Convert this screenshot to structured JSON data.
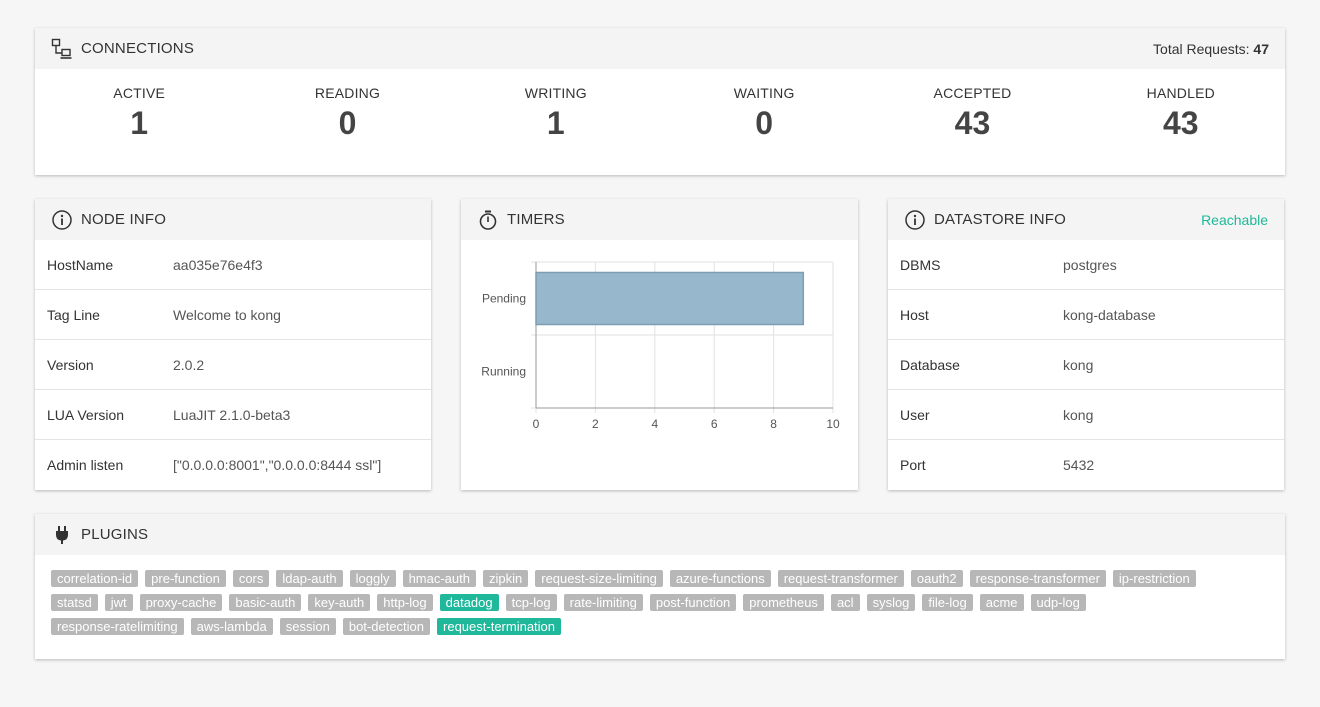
{
  "connections": {
    "title": "CONNECTIONS",
    "total_label": "Total Requests:",
    "total_value": "47",
    "stats": [
      {
        "label": "ACTIVE",
        "value": "1"
      },
      {
        "label": "READING",
        "value": "0"
      },
      {
        "label": "WRITING",
        "value": "1"
      },
      {
        "label": "WAITING",
        "value": "0"
      },
      {
        "label": "ACCEPTED",
        "value": "43"
      },
      {
        "label": "HANDLED",
        "value": "43"
      }
    ]
  },
  "node_info": {
    "title": "NODE INFO",
    "rows": [
      {
        "key": "HostName",
        "value": "aa035e76e4f3"
      },
      {
        "key": "Tag Line",
        "value": "Welcome to kong"
      },
      {
        "key": "Version",
        "value": "2.0.2"
      },
      {
        "key": "LUA Version",
        "value": "LuaJIT 2.1.0-beta3"
      },
      {
        "key": "Admin listen",
        "value": "[\"0.0.0.0:8001\",\"0.0.0.0:8444 ssl\"]"
      }
    ]
  },
  "timers": {
    "title": "TIMERS"
  },
  "chart_data": {
    "type": "bar",
    "orientation": "horizontal",
    "categories": [
      "Pending",
      "Running"
    ],
    "values": [
      9,
      0
    ],
    "xlim": [
      0,
      10
    ],
    "x_ticks": [
      "0",
      "2",
      "4",
      "6",
      "8",
      "10"
    ],
    "grid": true,
    "bar_color": "#97b8cc",
    "bar_stroke": "#7d9db2"
  },
  "datastore": {
    "title": "DATASTORE INFO",
    "status": "Reachable",
    "rows": [
      {
        "key": "DBMS",
        "value": "postgres"
      },
      {
        "key": "Host",
        "value": "kong-database"
      },
      {
        "key": "Database",
        "value": "kong"
      },
      {
        "key": "User",
        "value": "kong"
      },
      {
        "key": "Port",
        "value": "5432"
      }
    ]
  },
  "plugins": {
    "title": "PLUGINS",
    "items": [
      {
        "name": "correlation-id",
        "enabled": false
      },
      {
        "name": "pre-function",
        "enabled": false
      },
      {
        "name": "cors",
        "enabled": false
      },
      {
        "name": "ldap-auth",
        "enabled": false
      },
      {
        "name": "loggly",
        "enabled": false
      },
      {
        "name": "hmac-auth",
        "enabled": false
      },
      {
        "name": "zipkin",
        "enabled": false
      },
      {
        "name": "request-size-limiting",
        "enabled": false
      },
      {
        "name": "azure-functions",
        "enabled": false
      },
      {
        "name": "request-transformer",
        "enabled": false
      },
      {
        "name": "oauth2",
        "enabled": false
      },
      {
        "name": "response-transformer",
        "enabled": false
      },
      {
        "name": "ip-restriction",
        "enabled": false
      },
      {
        "name": "statsd",
        "enabled": false
      },
      {
        "name": "jwt",
        "enabled": false
      },
      {
        "name": "proxy-cache",
        "enabled": false
      },
      {
        "name": "basic-auth",
        "enabled": false
      },
      {
        "name": "key-auth",
        "enabled": false
      },
      {
        "name": "http-log",
        "enabled": false
      },
      {
        "name": "datadog",
        "enabled": true
      },
      {
        "name": "tcp-log",
        "enabled": false
      },
      {
        "name": "rate-limiting",
        "enabled": false
      },
      {
        "name": "post-function",
        "enabled": false
      },
      {
        "name": "prometheus",
        "enabled": false
      },
      {
        "name": "acl",
        "enabled": false
      },
      {
        "name": "syslog",
        "enabled": false
      },
      {
        "name": "file-log",
        "enabled": false
      },
      {
        "name": "acme",
        "enabled": false
      },
      {
        "name": "udp-log",
        "enabled": false
      },
      {
        "name": "response-ratelimiting",
        "enabled": false
      },
      {
        "name": "aws-lambda",
        "enabled": false
      },
      {
        "name": "session",
        "enabled": false
      },
      {
        "name": "bot-detection",
        "enabled": false
      },
      {
        "name": "request-termination",
        "enabled": true
      }
    ]
  },
  "colors": {
    "accent": "#1fb89a",
    "tag_inactive": "#b7b7b7"
  },
  "icons": {
    "connections": "network-icon",
    "node_info": "info-icon",
    "timers": "stopwatch-icon",
    "datastore": "info-icon",
    "plugins": "plug-icon"
  }
}
